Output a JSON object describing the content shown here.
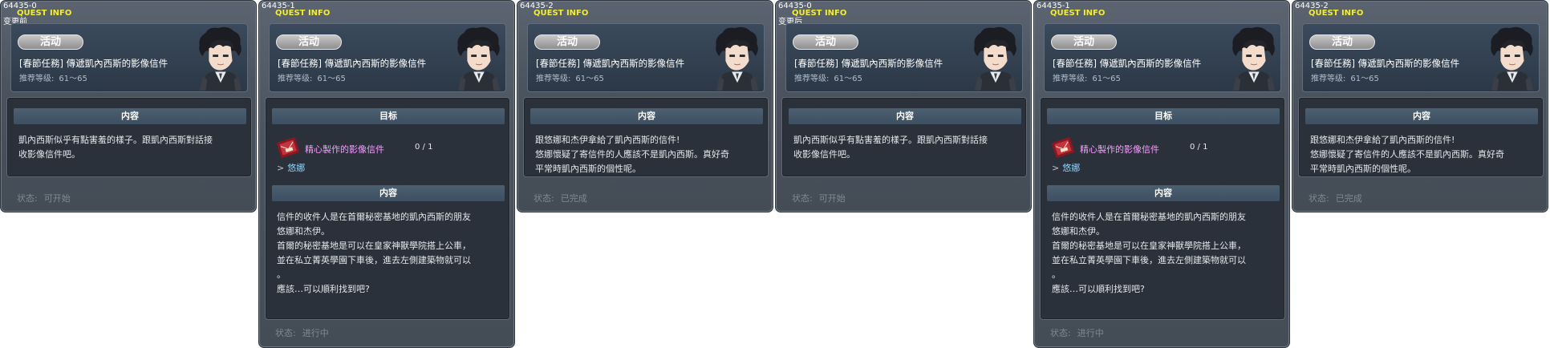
{
  "common": {
    "quest_info_label": "QUEST INFO",
    "category": "活动",
    "title": "[春節任務] 傳遞凱內西斯的影像信件",
    "level_label": "推荐等级:",
    "level_range": "61～65",
    "status_label": "状态:",
    "content_header": "内容",
    "goal_header": "目标"
  },
  "panels": [
    {
      "id": "64435-0",
      "sub": "变更前",
      "content": "凱內西斯似乎有點害羞的樣子。跟凱內西斯對話接\n收影像信件吧。",
      "status": "可开始"
    },
    {
      "id": "64435-1",
      "item_name": "精心製作的影像信件",
      "item_count": "0 / 1",
      "npc_name": "悠娜",
      "content": "信件的收件人是在首爾秘密基地的凱內西斯的朋友\n悠娜和杰伊。\n首爾的秘密基地是可以在皇家神獸學院搭上公車，\n並在私立菁英學園下車後，進去左側建築物就可以\n。\n應該…可以順利找到吧?",
      "status": "进行中"
    },
    {
      "id": "64435-2",
      "content": "跟悠娜和杰伊拿給了凱內西斯的信件!\n悠娜懷疑了寄信件的人應該不是凱內西斯。真好奇\n平常時凱內西斯的個性呢。",
      "status": "已完成"
    },
    {
      "id": "64435-0",
      "sub": "变更后",
      "content": "凱內西斯似乎有點害羞的樣子。跟凱內西斯對話接\n收影像信件吧。",
      "status": "可开始"
    },
    {
      "id": "64435-1",
      "item_name": "精心製作的影像信件",
      "item_count": "0 / 1",
      "npc_name": "悠娜",
      "content": "信件的收件人是在首爾秘密基地的凱內西斯的朋友\n悠娜和杰伊。\n首爾的秘密基地是可以在皇家神獸學院搭上公車，\n並在私立菁英學園下車後，進去左側建築物就可以\n。\n應該…可以順利找到吧?",
      "status": "进行中"
    },
    {
      "id": "64435-2",
      "content": "跟悠娜和杰伊拿給了凱內西斯的信件!\n悠娜懷疑了寄信件的人應該不是凱內西斯。真好奇\n平常時凱內西斯的個性呢。",
      "status": "已完成"
    }
  ]
}
